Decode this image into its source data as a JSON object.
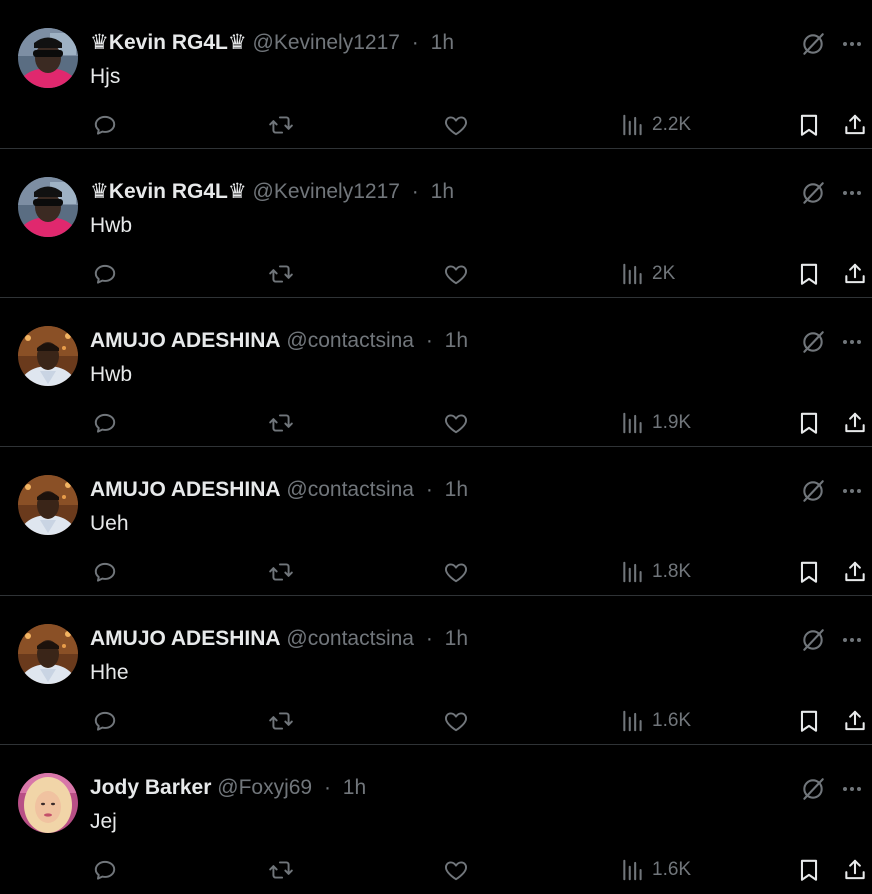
{
  "theme": {
    "background": "#000000",
    "text_primary": "#e7e9ea",
    "text_secondary": "#71767b",
    "divider": "#2f3336"
  },
  "icons": {
    "grok": "grok-icon",
    "more": "more-dots-icon",
    "reply": "reply-icon",
    "repost": "repost-icon",
    "like": "heart-icon",
    "views": "views-chart-icon",
    "bookmark": "bookmark-icon",
    "share": "share-icon"
  },
  "posts": [
    {
      "name": "♛Kevin RG4L♛",
      "handle": "@Kevinely1217",
      "dot": "·",
      "time": "1h",
      "text": "Hjs",
      "views": "2.2K",
      "avatar": "kevin"
    },
    {
      "name": "♛Kevin RG4L♛",
      "handle": "@Kevinely1217",
      "dot": "·",
      "time": "1h",
      "text": "Hwb",
      "views": "2K",
      "avatar": "kevin"
    },
    {
      "name": "AMUJO ADESHINA",
      "handle": "@contactsina",
      "dot": "·",
      "time": "1h",
      "text": "Hwb",
      "views": "1.9K",
      "avatar": "amujo"
    },
    {
      "name": "AMUJO ADESHINA",
      "handle": "@contactsina",
      "dot": "·",
      "time": "1h",
      "text": "Ueh",
      "views": "1.8K",
      "avatar": "amujo"
    },
    {
      "name": "AMUJO ADESHINA",
      "handle": "@contactsina",
      "dot": "·",
      "time": "1h",
      "text": "Hhe",
      "views": "1.6K",
      "avatar": "amujo"
    },
    {
      "name": "Jody Barker",
      "handle": "@Foxyj69",
      "dot": "·",
      "time": "1h",
      "text": "Jej",
      "views": "1.6K",
      "avatar": "jody"
    }
  ]
}
